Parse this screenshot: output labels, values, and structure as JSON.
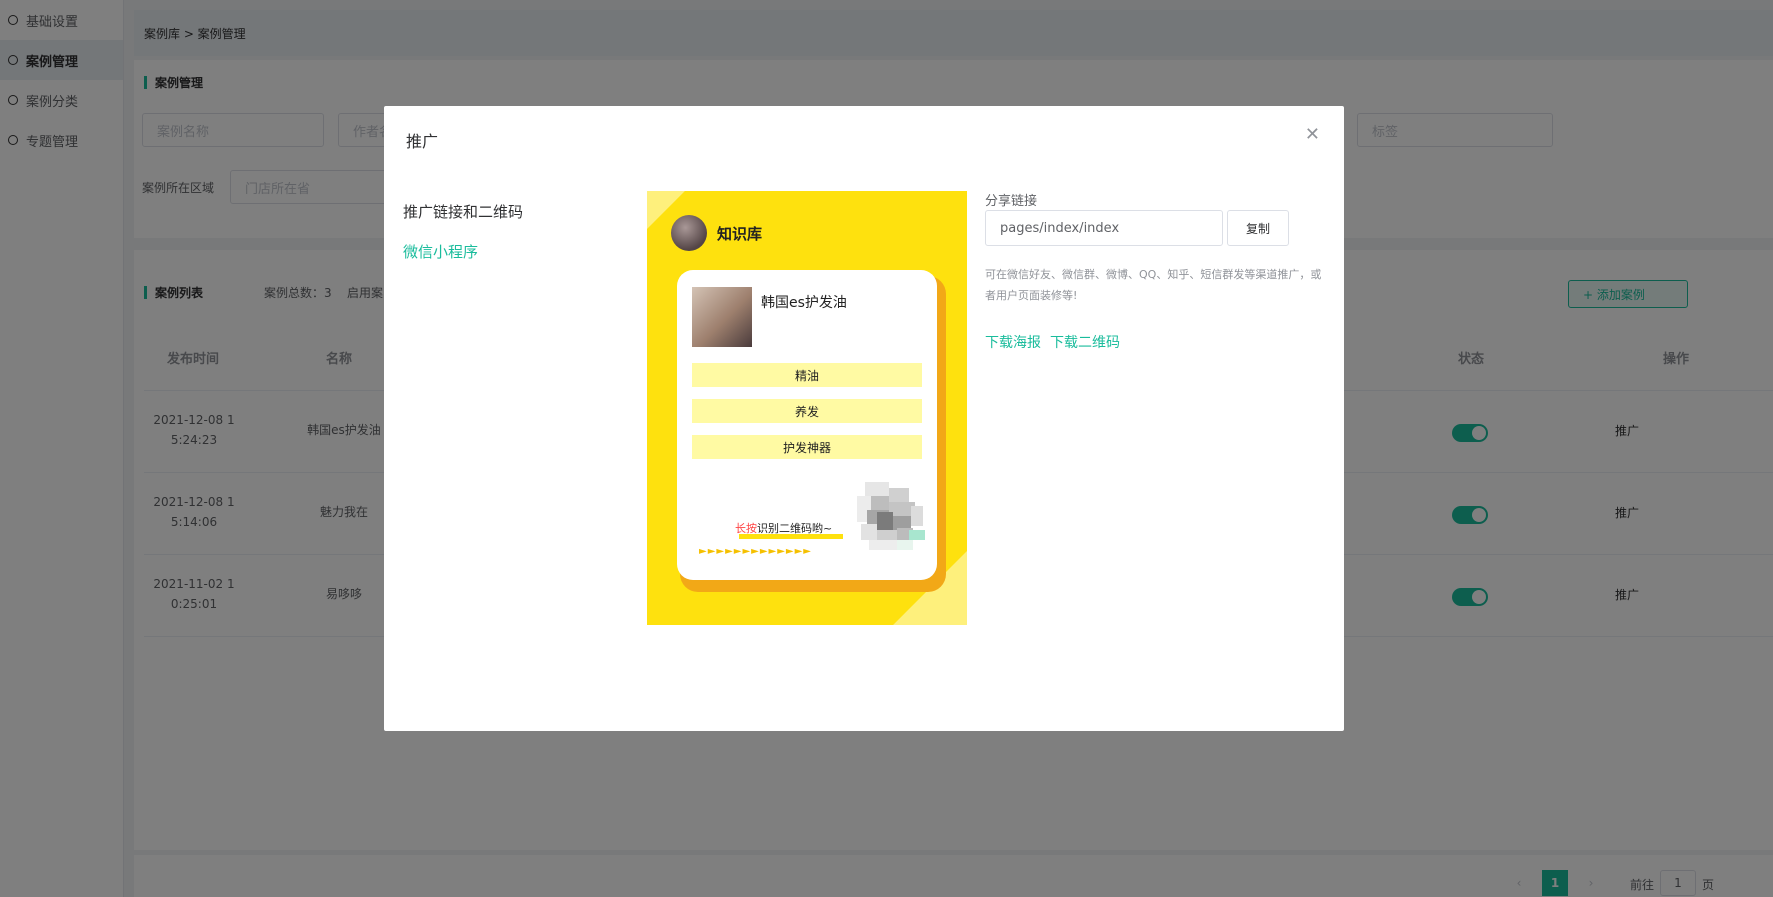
{
  "sidebar": {
    "items": [
      {
        "label": "基础设置"
      },
      {
        "label": "案例管理"
      },
      {
        "label": "案例分类"
      },
      {
        "label": "专题管理"
      }
    ]
  },
  "breadcrumb": "案例库 > 案例管理",
  "filter": {
    "title": "案例管理",
    "name_placeholder": "案例名称",
    "author_placeholder": "作者名",
    "tag_placeholder": "标签",
    "region_label": "案例所在区域",
    "region_placeholder": "门店所在省"
  },
  "list": {
    "title": "案例列表",
    "total": "案例总数：3",
    "enabled_partial": "启用案",
    "add_button": "+ 添加案例",
    "headers": {
      "time": "发布时间",
      "name": "名称",
      "status": "状态",
      "ops": "操作"
    },
    "rows": [
      {
        "time1": "2021-12-08 1",
        "time2": "5:24:23",
        "name": "韩国es护发油",
        "op": "推广"
      },
      {
        "time1": "2021-12-08 1",
        "time2": "5:14:06",
        "name": "魅力我在",
        "op": "推广"
      },
      {
        "time1": "2021-11-02 1",
        "time2": "0:25:01",
        "name": "易哆哆",
        "op": "推广"
      }
    ]
  },
  "pagination": {
    "current": "1",
    "goto_label": "前往",
    "goto_value": "1",
    "page_unit": "页"
  },
  "dialog": {
    "title": "推广",
    "left_title": "推广链接和二维码",
    "left_link": "微信小程序",
    "poster": {
      "shop_name": "知识库",
      "product_title": "韩国es护发油",
      "tags": [
        "精油",
        "养发",
        "护发神器"
      ],
      "tip_red": "长按",
      "tip_rest": "识别二维码哟~",
      "arrows": "►►►►►►►►►►►►►"
    },
    "share_label": "分享链接",
    "share_value": "pages/index/index",
    "copy_button": "复制",
    "share_desc": "可在微信好友、微信群、微博、QQ、知乎、短信群发等渠道推广，或者用户页面装修等!",
    "download_poster": "下载海报",
    "download_qrcode": "下载二维码"
  },
  "colors": {
    "accent": "#1abc9c",
    "poster_bg": "#fee10e",
    "tag_bg": "#fffaa3"
  }
}
